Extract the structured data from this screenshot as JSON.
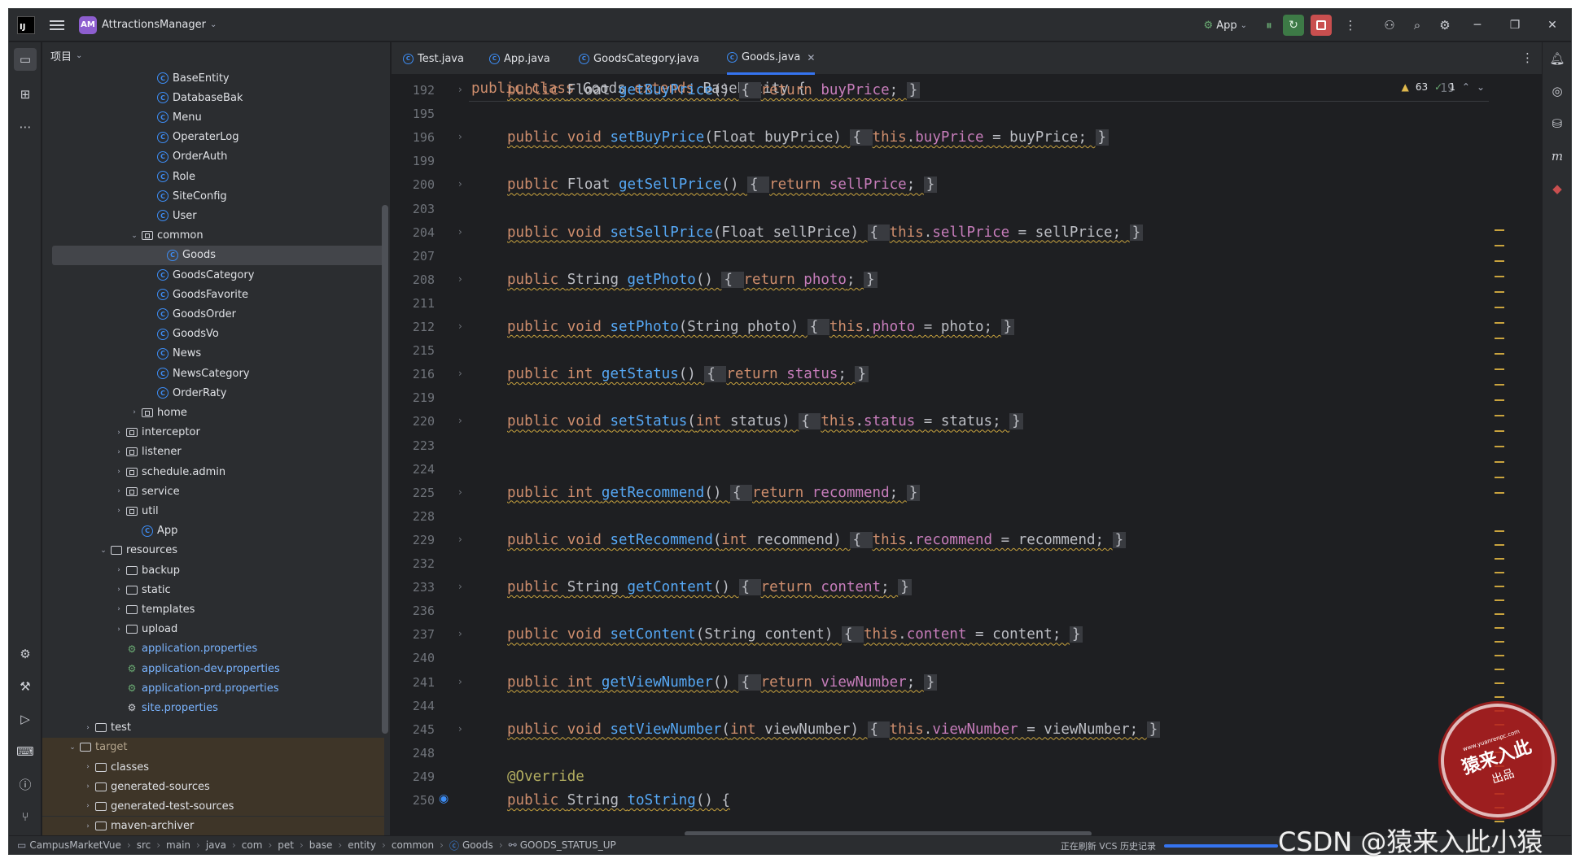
{
  "titlebar": {
    "project_badge": "AM",
    "project_name": "AttractionsManager",
    "run_config": "App"
  },
  "project_panel": {
    "header": "项目",
    "rows": [
      {
        "label": "BaseEntity",
        "icon": "class-icon",
        "indent": 5,
        "arrow": ""
      },
      {
        "label": "DatabaseBak",
        "icon": "class-icon",
        "indent": 5,
        "arrow": ""
      },
      {
        "label": "Menu",
        "icon": "class-icon",
        "indent": 5,
        "arrow": ""
      },
      {
        "label": "OperaterLog",
        "icon": "class-icon",
        "indent": 5,
        "arrow": ""
      },
      {
        "label": "OrderAuth",
        "icon": "class-icon",
        "indent": 5,
        "arrow": ""
      },
      {
        "label": "Role",
        "icon": "class-icon",
        "indent": 5,
        "arrow": ""
      },
      {
        "label": "SiteConfig",
        "icon": "class-icon",
        "indent": 5,
        "arrow": ""
      },
      {
        "label": "User",
        "icon": "class-icon",
        "indent": 5,
        "arrow": ""
      },
      {
        "label": "common",
        "icon": "package-icon",
        "indent": 4,
        "arrow": "down"
      },
      {
        "label": "Goods",
        "icon": "class-icon",
        "indent": 5,
        "arrow": "",
        "selected": true
      },
      {
        "label": "GoodsCategory",
        "icon": "class-icon",
        "indent": 5,
        "arrow": ""
      },
      {
        "label": "GoodsFavorite",
        "icon": "class-icon",
        "indent": 5,
        "arrow": ""
      },
      {
        "label": "GoodsOrder",
        "icon": "class-icon",
        "indent": 5,
        "arrow": ""
      },
      {
        "label": "GoodsVo",
        "icon": "class-icon",
        "indent": 5,
        "arrow": ""
      },
      {
        "label": "News",
        "icon": "class-icon",
        "indent": 5,
        "arrow": ""
      },
      {
        "label": "NewsCategory",
        "icon": "class-icon",
        "indent": 5,
        "arrow": ""
      },
      {
        "label": "OrderRaty",
        "icon": "class-icon",
        "indent": 5,
        "arrow": ""
      },
      {
        "label": "home",
        "icon": "package-icon",
        "indent": 4,
        "arrow": "right"
      },
      {
        "label": "interceptor",
        "icon": "package-icon",
        "indent": 3,
        "arrow": "right"
      },
      {
        "label": "listener",
        "icon": "package-icon",
        "indent": 3,
        "arrow": "right"
      },
      {
        "label": "schedule.admin",
        "icon": "package-icon",
        "indent": 3,
        "arrow": "right"
      },
      {
        "label": "service",
        "icon": "package-icon",
        "indent": 3,
        "arrow": "right"
      },
      {
        "label": "util",
        "icon": "package-icon",
        "indent": 3,
        "arrow": "right"
      },
      {
        "label": "App",
        "icon": "class-icon",
        "indent": 4,
        "arrow": ""
      },
      {
        "label": "resources",
        "icon": "folder-icon",
        "indent": 2,
        "arrow": "down"
      },
      {
        "label": "backup",
        "icon": "folder-icon",
        "indent": 3,
        "arrow": "right"
      },
      {
        "label": "static",
        "icon": "folder-icon",
        "indent": 3,
        "arrow": "right"
      },
      {
        "label": "templates",
        "icon": "folder-icon",
        "indent": 3,
        "arrow": "right"
      },
      {
        "label": "upload",
        "icon": "folder-icon",
        "indent": 3,
        "arrow": "right"
      },
      {
        "label": "application.properties",
        "icon": "properties-icon",
        "indent": 3,
        "arrow": "",
        "style": "blue"
      },
      {
        "label": "application-dev.properties",
        "icon": "properties-icon",
        "indent": 3,
        "arrow": "",
        "style": "blue"
      },
      {
        "label": "application-prd.properties",
        "icon": "properties-icon",
        "indent": 3,
        "arrow": "",
        "style": "blue"
      },
      {
        "label": "site.properties",
        "icon": "settings-icon",
        "indent": 3,
        "arrow": "",
        "style": "blue"
      },
      {
        "label": "test",
        "icon": "folder-icon",
        "indent": 1,
        "arrow": "right"
      },
      {
        "label": "target",
        "icon": "folder-icon",
        "indent": 0,
        "arrow": "down",
        "style": "excluded"
      },
      {
        "label": "classes",
        "icon": "folder-icon",
        "indent": 1,
        "arrow": "right",
        "style": "excluded"
      },
      {
        "label": "generated-sources",
        "icon": "folder-icon",
        "indent": 1,
        "arrow": "right",
        "style": "excluded"
      },
      {
        "label": "generated-test-sources",
        "icon": "folder-icon",
        "indent": 1,
        "arrow": "right",
        "style": "excluded"
      },
      {
        "label": "maven-archiver",
        "icon": "folder-icon",
        "indent": 1,
        "arrow": "right",
        "style": "excluded"
      }
    ]
  },
  "tabs": [
    {
      "label": "Test.java",
      "active": false
    },
    {
      "label": "App.java",
      "active": false
    },
    {
      "label": "GoodsCategory.java",
      "active": false
    },
    {
      "label": "Goods.java",
      "active": true
    }
  ],
  "inspections": {
    "warnings": "63",
    "ok": "1"
  },
  "sticky_line": {
    "number": "19",
    "code": [
      [
        "kw",
        "public class "
      ],
      [
        "tx",
        "Goods "
      ],
      [
        "kw",
        "extends "
      ],
      [
        "tx",
        "BaseEntity {"
      ]
    ]
  },
  "code_lines": [
    {
      "n": "192",
      "fold": true,
      "code": [
        [
          "kw",
          "public "
        ],
        [
          "tx",
          "Float "
        ],
        [
          "fn",
          "getBuyPrice"
        ],
        [
          "tx",
          "() "
        ],
        [
          "br",
          "{ "
        ],
        [
          "kw",
          "return "
        ],
        [
          "fld",
          "buyPrice"
        ],
        [
          "tx",
          "; "
        ],
        [
          "br",
          "}"
        ]
      ]
    },
    {
      "n": "195",
      "fold": false,
      "code": []
    },
    {
      "n": "196",
      "fold": true,
      "code": [
        [
          "kw",
          "public void "
        ],
        [
          "fn",
          "setBuyPrice"
        ],
        [
          "tx",
          "(Float buyPrice) "
        ],
        [
          "br",
          "{ "
        ],
        [
          "kw",
          "this"
        ],
        [
          "tx",
          "."
        ],
        [
          "fld",
          "buyPrice"
        ],
        [
          "tx",
          " = buyPrice; "
        ],
        [
          "br",
          "}"
        ]
      ]
    },
    {
      "n": "199",
      "fold": false,
      "code": []
    },
    {
      "n": "200",
      "fold": true,
      "code": [
        [
          "kw",
          "public "
        ],
        [
          "tx",
          "Float "
        ],
        [
          "fn",
          "getSellPrice"
        ],
        [
          "tx",
          "() "
        ],
        [
          "br",
          "{ "
        ],
        [
          "kw",
          "return "
        ],
        [
          "fld",
          "sellPrice"
        ],
        [
          "tx",
          "; "
        ],
        [
          "br",
          "}"
        ]
      ]
    },
    {
      "n": "203",
      "fold": false,
      "code": []
    },
    {
      "n": "204",
      "fold": true,
      "code": [
        [
          "kw",
          "public void "
        ],
        [
          "fn",
          "setSellPrice"
        ],
        [
          "tx",
          "(Float sellPrice) "
        ],
        [
          "br",
          "{ "
        ],
        [
          "kw",
          "this"
        ],
        [
          "tx",
          "."
        ],
        [
          "fld",
          "sellPrice"
        ],
        [
          "tx",
          " = sellPrice; "
        ],
        [
          "br",
          "}"
        ]
      ]
    },
    {
      "n": "207",
      "fold": false,
      "code": []
    },
    {
      "n": "208",
      "fold": true,
      "code": [
        [
          "kw",
          "public "
        ],
        [
          "tx",
          "String "
        ],
        [
          "fn",
          "getPhoto"
        ],
        [
          "tx",
          "() "
        ],
        [
          "br",
          "{ "
        ],
        [
          "kw",
          "return "
        ],
        [
          "fld",
          "photo"
        ],
        [
          "tx",
          "; "
        ],
        [
          "br",
          "}"
        ]
      ]
    },
    {
      "n": "211",
      "fold": false,
      "code": []
    },
    {
      "n": "212",
      "fold": true,
      "code": [
        [
          "kw",
          "public void "
        ],
        [
          "fn",
          "setPhoto"
        ],
        [
          "tx",
          "(String photo) "
        ],
        [
          "br",
          "{ "
        ],
        [
          "kw",
          "this"
        ],
        [
          "tx",
          "."
        ],
        [
          "fld",
          "photo"
        ],
        [
          "tx",
          " = photo; "
        ],
        [
          "br",
          "}"
        ]
      ]
    },
    {
      "n": "215",
      "fold": false,
      "code": []
    },
    {
      "n": "216",
      "fold": true,
      "code": [
        [
          "kw",
          "public int "
        ],
        [
          "fn",
          "getStatus"
        ],
        [
          "tx",
          "() "
        ],
        [
          "br",
          "{ "
        ],
        [
          "kw",
          "return "
        ],
        [
          "fld",
          "status"
        ],
        [
          "tx",
          "; "
        ],
        [
          "br",
          "}"
        ]
      ]
    },
    {
      "n": "219",
      "fold": false,
      "code": []
    },
    {
      "n": "220",
      "fold": true,
      "code": [
        [
          "kw",
          "public void "
        ],
        [
          "fn",
          "setStatus"
        ],
        [
          "tx",
          "("
        ],
        [
          "kw",
          "int "
        ],
        [
          "tx",
          "status) "
        ],
        [
          "br",
          "{ "
        ],
        [
          "kw",
          "this"
        ],
        [
          "tx",
          "."
        ],
        [
          "fld",
          "status"
        ],
        [
          "tx",
          " = status; "
        ],
        [
          "br",
          "}"
        ]
      ]
    },
    {
      "n": "223",
      "fold": false,
      "code": []
    },
    {
      "n": "224",
      "fold": false,
      "code": []
    },
    {
      "n": "225",
      "fold": true,
      "code": [
        [
          "kw",
          "public int "
        ],
        [
          "fn",
          "getRecommend"
        ],
        [
          "tx",
          "() "
        ],
        [
          "br",
          "{ "
        ],
        [
          "kw",
          "return "
        ],
        [
          "fld",
          "recommend"
        ],
        [
          "tx",
          "; "
        ],
        [
          "br",
          "}"
        ]
      ]
    },
    {
      "n": "228",
      "fold": false,
      "code": []
    },
    {
      "n": "229",
      "fold": true,
      "code": [
        [
          "kw",
          "public void "
        ],
        [
          "fn",
          "setRecommend"
        ],
        [
          "tx",
          "("
        ],
        [
          "kw",
          "int "
        ],
        [
          "tx",
          "recommend) "
        ],
        [
          "br",
          "{ "
        ],
        [
          "kw",
          "this"
        ],
        [
          "tx",
          "."
        ],
        [
          "fld",
          "recommend"
        ],
        [
          "tx",
          " = recommend; "
        ],
        [
          "br",
          "}"
        ]
      ]
    },
    {
      "n": "232",
      "fold": false,
      "code": []
    },
    {
      "n": "233",
      "fold": true,
      "code": [
        [
          "kw",
          "public "
        ],
        [
          "tx",
          "String "
        ],
        [
          "fn",
          "getContent"
        ],
        [
          "tx",
          "() "
        ],
        [
          "br",
          "{ "
        ],
        [
          "kw",
          "return "
        ],
        [
          "fld",
          "content"
        ],
        [
          "tx",
          "; "
        ],
        [
          "br",
          "}"
        ]
      ]
    },
    {
      "n": "236",
      "fold": false,
      "code": []
    },
    {
      "n": "237",
      "fold": true,
      "code": [
        [
          "kw",
          "public void "
        ],
        [
          "fn",
          "setContent"
        ],
        [
          "tx",
          "(String content) "
        ],
        [
          "br",
          "{ "
        ],
        [
          "kw",
          "this"
        ],
        [
          "tx",
          "."
        ],
        [
          "fld",
          "content"
        ],
        [
          "tx",
          " = content; "
        ],
        [
          "br",
          "}"
        ]
      ]
    },
    {
      "n": "240",
      "fold": false,
      "code": []
    },
    {
      "n": "241",
      "fold": true,
      "code": [
        [
          "kw",
          "public int "
        ],
        [
          "fn",
          "getViewNumber"
        ],
        [
          "tx",
          "() "
        ],
        [
          "br",
          "{ "
        ],
        [
          "kw",
          "return "
        ],
        [
          "fld",
          "viewNumber"
        ],
        [
          "tx",
          "; "
        ],
        [
          "br",
          "}"
        ]
      ]
    },
    {
      "n": "244",
      "fold": false,
      "code": []
    },
    {
      "n": "245",
      "fold": true,
      "code": [
        [
          "kw",
          "public void "
        ],
        [
          "fn",
          "setViewNumber"
        ],
        [
          "tx",
          "("
        ],
        [
          "kw",
          "int "
        ],
        [
          "tx",
          "viewNumber) "
        ],
        [
          "br",
          "{ "
        ],
        [
          "kw",
          "this"
        ],
        [
          "tx",
          "."
        ],
        [
          "fld",
          "viewNumber"
        ],
        [
          "tx",
          " = viewNumber; "
        ],
        [
          "br",
          "}"
        ]
      ]
    },
    {
      "n": "248",
      "fold": false,
      "code": []
    },
    {
      "n": "249",
      "fold": false,
      "code": [
        [
          "an",
          "@Override"
        ]
      ]
    },
    {
      "n": "250",
      "fold": false,
      "override": true,
      "code": [
        [
          "kw",
          "public "
        ],
        [
          "tx",
          "String "
        ],
        [
          "fn",
          "toString"
        ],
        [
          "tx",
          "() {"
        ]
      ]
    }
  ],
  "statusbar": {
    "breadcrumbs": [
      "CampusMarketVue",
      "src",
      "main",
      "java",
      "com",
      "pet",
      "base",
      "entity",
      "common",
      "Goods",
      "GOODS_STATUS_UP"
    ],
    "progress_text": "正在刷新 VCS 历史记录"
  },
  "watermark": {
    "seal_url": "www.yuanrenpc.com",
    "seal_main": "猿来入此",
    "seal_sub": "出品",
    "credit": "CSDN @猿来入此小猿"
  }
}
